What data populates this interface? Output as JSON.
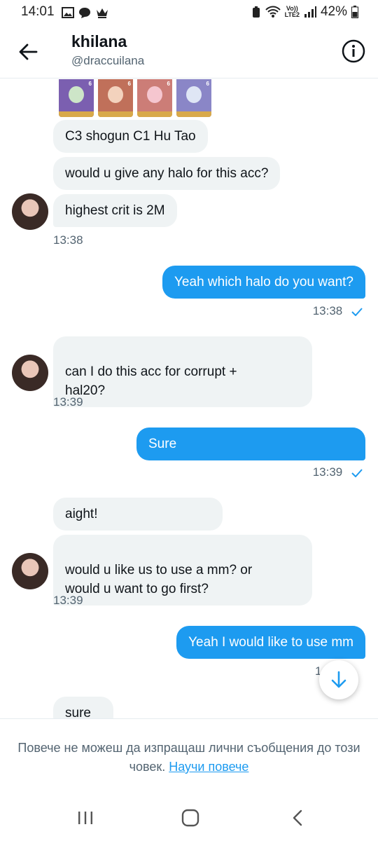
{
  "status_bar": {
    "time": "14:01",
    "network": "LTE2",
    "volte": "Vo))",
    "battery": "42%"
  },
  "header": {
    "name": "khilana",
    "handle": "@draccuilana"
  },
  "messages": {
    "m1": "C3 shogun C1 Hu Tao",
    "m2": "would u give any halo for this acc?",
    "m3": "highest crit is 2M",
    "t1": "13:38",
    "m4": "Yeah which halo do you want?",
    "t2": "13:38",
    "m5": "can I do this acc for corrupt +\nhal20?",
    "t3": "13:39",
    "m6": "Sure",
    "t4": "13:39",
    "m7": "aight!",
    "m8": "would u like us to use a mm? or\nwould u want to go first?",
    "t5": "13:39",
    "m9": "Yeah I would like to use mm",
    "t6": "1",
    "m10": "sure"
  },
  "character_thumbnails": [
    {
      "badge": "6",
      "color": "#7b5fb0"
    },
    {
      "badge": "6",
      "color": "#c0705a"
    },
    {
      "badge": "6",
      "color": "#cc7d77"
    },
    {
      "badge": "6",
      "color": "#8a86c7"
    }
  ],
  "footer": {
    "notice": "Повече не можеш да изпращаш лични съобщения до този човек.",
    "learn_more": "Научи повече"
  },
  "colors": {
    "accent": "#1d9bf0",
    "incoming_bubble": "#eff3f4",
    "secondary_text": "#536471"
  }
}
